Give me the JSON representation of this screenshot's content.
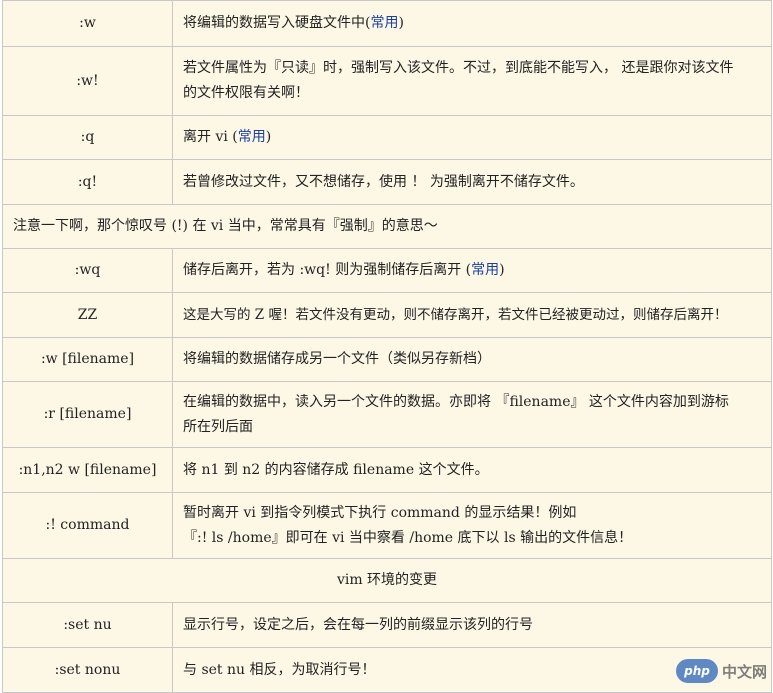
{
  "rows": [
    {
      "cmd": ":w",
      "desc": "将编辑的数据写入硬盘文件中(",
      "tag": "常用",
      "tail": ")"
    },
    {
      "cmd": ":w!",
      "line1": "若文件属性为『只读』时，强制写入该文件。不过，到底能不能写入， 还是跟你对该文件",
      "line2": "的文件权限有关啊！"
    },
    {
      "cmd": ":q",
      "desc": "离开 vi (",
      "tag": "常用",
      "tail": ")"
    },
    {
      "cmd": ":q!",
      "desc": "若曾修改过文件，又不想储存，使用 ！ 为强制离开不储存文件。"
    },
    {
      "note": "注意一下啊，那个惊叹号 (!) 在 vi 当中，常常具有『强制』的意思～"
    },
    {
      "cmd": ":wq",
      "desc": "储存后离开，若为 :wq! 则为强制储存后离开 (",
      "tag": "常用",
      "tail": ")"
    },
    {
      "cmd": "ZZ",
      "desc": "这是大写的 Z 喔！若文件没有更动，则不储存离开，若文件已经被更动过，则储存后离开！"
    },
    {
      "cmd": ":w [filename]",
      "desc": "将编辑的数据储存成另一个文件（类似另存新档）"
    },
    {
      "cmd": ":r [filename]",
      "line1": "在编辑的数据中，读入另一个文件的数据。亦即将 『filename』 这个文件内容加到游标",
      "line2": "所在列后面"
    },
    {
      "cmd": ":n1,n2 w [filename]",
      "desc": "将 n1 到 n2 的内容储存成 filename 这个文件。"
    },
    {
      "cmd": ":! command",
      "line1": "暂时离开 vi 到指令列模式下执行 command 的显示结果！例如",
      "line2": "『:! ls /home』即可在 vi 当中察看 /home 底下以 ls 输出的文件信息！"
    },
    {
      "section": "vim 环境的变更"
    },
    {
      "cmd": ":set nu",
      "desc": "显示行号，设定之后，会在每一列的前缀显示该列的行号"
    },
    {
      "cmd": ":set nonu",
      "desc": "与 set nu 相反，为取消行号！"
    }
  ],
  "watermark": {
    "logo": "php",
    "text": "中文网"
  },
  "colors": {
    "cell_bg": "#fdf8e6",
    "header_bg": "#b4dcee",
    "tag": "#1a3fa3"
  }
}
